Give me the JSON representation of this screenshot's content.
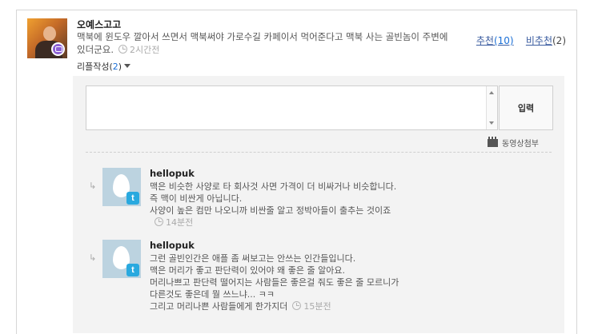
{
  "comment": {
    "author": "오예스고고",
    "text": "맥북에 윈도우 깔아서 쓰면서 맥북써야 가로수길 카페이서 먹어준다고 맥북 사는 골빈놈이 주변에 있더군요.",
    "time": "2시간전",
    "upvote_label": "추천",
    "upvote_count": "(10)",
    "downvote_label": "비추천",
    "downvote_count": "(2)",
    "reply_label": "리플작성",
    "reply_count": "2",
    "reply_open": "(",
    "reply_close": ")"
  },
  "reply_form": {
    "submit_label": "입력",
    "video_attach_label": "동영상첨부"
  },
  "replies": [
    {
      "author": "hellopuk",
      "lines": [
        "맥은 비슷한 사양로 타 회사것 사면 가격이 더 비싸거나 비슷합니다.",
        "즉 맥이 비싼게 아닙니다.",
        "사양이 높은 컴만 나오니까 비싼줄 알고 정박아들이 출추는 것이죠"
      ],
      "time": "14분전"
    },
    {
      "author": "hellopuk",
      "lines": [
        "그런 골빈인간은 애플 좀 써보고는 안쓰는 인간들입니다.",
        "맥은 머리가 좋고 판단력이 있어야 왜 좋은 줄 알아요.",
        "머리나쁘고 판단력 떨어지는 사람들은 좋은걸 줘도 좋은 줄 모르니가",
        "다른것도 좋은데 뭘 쓰느냐... ㅋㅋ",
        "그리고 머리나쁜 사람들에게 한가지더"
      ],
      "time": "15분전"
    }
  ],
  "icons": {
    "reply_arrow": "↳",
    "twitter_glyph": "t"
  }
}
